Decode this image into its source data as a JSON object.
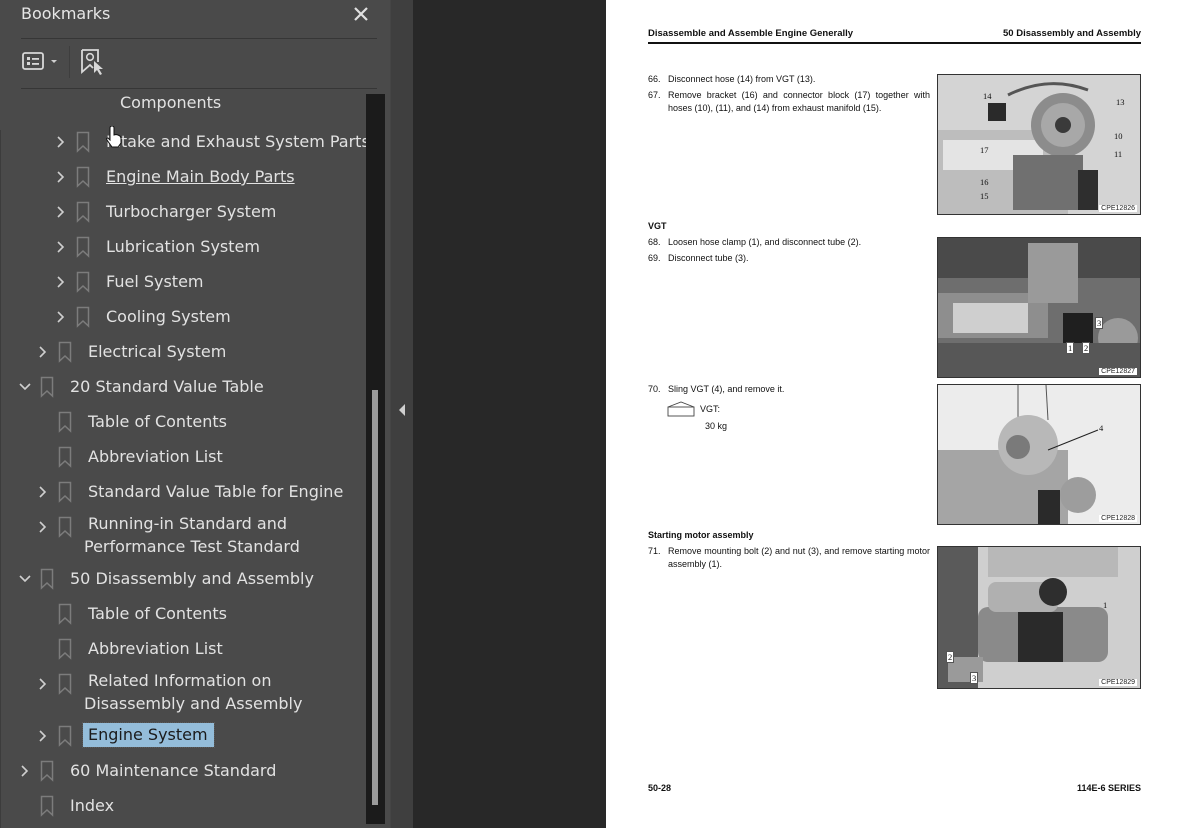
{
  "panel": {
    "title": "Bookmarks",
    "close_icon": "close-icon",
    "toolbar": {
      "options_icon": "list-options-icon",
      "find_bookmark_icon": "find-current-bookmark-icon"
    },
    "items": [
      {
        "label": "Components",
        "level": 3,
        "expander": "none",
        "partial": true
      },
      {
        "label": "Intake and Exhaust System Parts",
        "level": 3,
        "expander": "collapsed"
      },
      {
        "label": "Engine Main Body Parts",
        "level": 3,
        "expander": "collapsed",
        "hovered": true
      },
      {
        "label": "Turbocharger System",
        "level": 3,
        "expander": "collapsed"
      },
      {
        "label": "Lubrication System",
        "level": 3,
        "expander": "collapsed"
      },
      {
        "label": "Fuel System",
        "level": 3,
        "expander": "collapsed"
      },
      {
        "label": "Cooling System",
        "level": 3,
        "expander": "collapsed"
      },
      {
        "label": "Electrical System",
        "level": 2,
        "expander": "collapsed"
      },
      {
        "label": "20 Standard Value Table",
        "level": 1,
        "expander": "expanded"
      },
      {
        "label": "Table of Contents",
        "level": 2,
        "expander": "none"
      },
      {
        "label": "Abbreviation List",
        "level": 2,
        "expander": "none"
      },
      {
        "label": "Standard Value Table for Engine",
        "level": 2,
        "expander": "collapsed"
      },
      {
        "label": "Running-in Standard and Performance Test Standard",
        "level": 2,
        "expander": "collapsed"
      },
      {
        "label": "50 Disassembly and Assembly",
        "level": 1,
        "expander": "expanded"
      },
      {
        "label": "Table of Contents",
        "level": 2,
        "expander": "none"
      },
      {
        "label": "Abbreviation List",
        "level": 2,
        "expander": "none"
      },
      {
        "label": "Related Information on Disassembly and Assembly",
        "level": 2,
        "expander": "collapsed"
      },
      {
        "label": "Engine System",
        "level": 2,
        "expander": "collapsed",
        "selected": true
      },
      {
        "label": "60 Maintenance Standard",
        "level": 1,
        "expander": "collapsed"
      },
      {
        "label": "Index",
        "level": 1,
        "expander": "none"
      }
    ],
    "colors": {
      "panel_bg": "#4a4a4a",
      "selected_bg": "#94bdda",
      "text": "#e2e2e2"
    }
  },
  "splitter": {
    "collapse_icon": "collapse-left-arrow-icon"
  },
  "page": {
    "header_left": "Disassemble and Assemble Engine Generally",
    "header_right": "50 Disassembly and Assembly",
    "steps": [
      {
        "num": "66.",
        "text": "Disconnect hose (14) from VGT (13)."
      },
      {
        "num": "67.",
        "text": "Remove bracket (16) and connector block (17) together with hoses (10), (11), and (14) from exhaust manifold (15)."
      },
      {
        "num": "68.",
        "text": "Loosen hose clamp (1), and disconnect tube (2)."
      },
      {
        "num": "69.",
        "text": "Disconnect tube (3)."
      },
      {
        "num": "70.",
        "text": "Sling VGT (4), and remove it."
      },
      {
        "num": "71.",
        "text": "Remove mounting bolt (2) and nut (3), and remove starting motor assembly (1)."
      }
    ],
    "sections": {
      "vgt": "VGT",
      "starting_motor": "Starting motor assembly"
    },
    "weight": {
      "label": "VGT:",
      "value": "30 kg",
      "icon": "weight-icon"
    },
    "figures": [
      {
        "caption": "CPE12826",
        "labels": [
          "14",
          "13",
          "10",
          "11",
          "17",
          "16",
          "15"
        ]
      },
      {
        "caption": "CPE12827",
        "labels": [
          "3",
          "1",
          "2"
        ]
      },
      {
        "caption": "CPE12828",
        "labels": [
          "4"
        ]
      },
      {
        "caption": "CPE12829",
        "labels": [
          "1",
          "2",
          "3"
        ]
      }
    ],
    "footer_left": "50-28",
    "footer_right": "114E-6 SERIES"
  }
}
